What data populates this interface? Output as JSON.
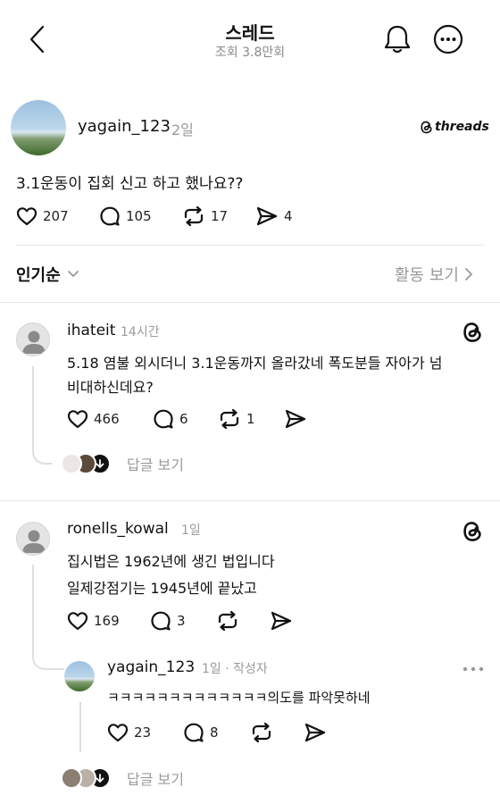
{
  "header": {
    "title": "스레드",
    "subtitle": "조회 3.8만회"
  },
  "post": {
    "username": "yagain_123",
    "time": "2일",
    "brand": "threads",
    "text": "3.1운동이 집회 신고 하고 했나요??",
    "likes": "207",
    "comments": "105",
    "reposts": "17",
    "shares": "4"
  },
  "sort": {
    "label": "인기순",
    "activity": "활동 보기"
  },
  "replies": [
    {
      "username": "ihateit",
      "time": "14시간",
      "line1": "5.18 염불 외시더니 3.1운동까지 올라갔네 폭도분들 자아가 넘",
      "line2": "비대하신데요?",
      "likes": "466",
      "comments": "6",
      "reposts": "1",
      "view_replies": "답글 보기"
    },
    {
      "username": "ronells_kowal",
      "time": "1일",
      "line1": "집시법은 1962년에 생긴 법입니다",
      "line2": "일제강점기는 1945년에 끝났고",
      "likes": "169",
      "comments": "3",
      "nested": {
        "username": "yagain_123",
        "time": "1일 · 작성자",
        "text": "ㅋㅋㅋㅋㅋㅋㅋㅋㅋㅋㅋㅋㅋ의도를 파악못하네",
        "likes": "23",
        "comments": "8"
      },
      "view_replies": "답글 보기"
    }
  ]
}
